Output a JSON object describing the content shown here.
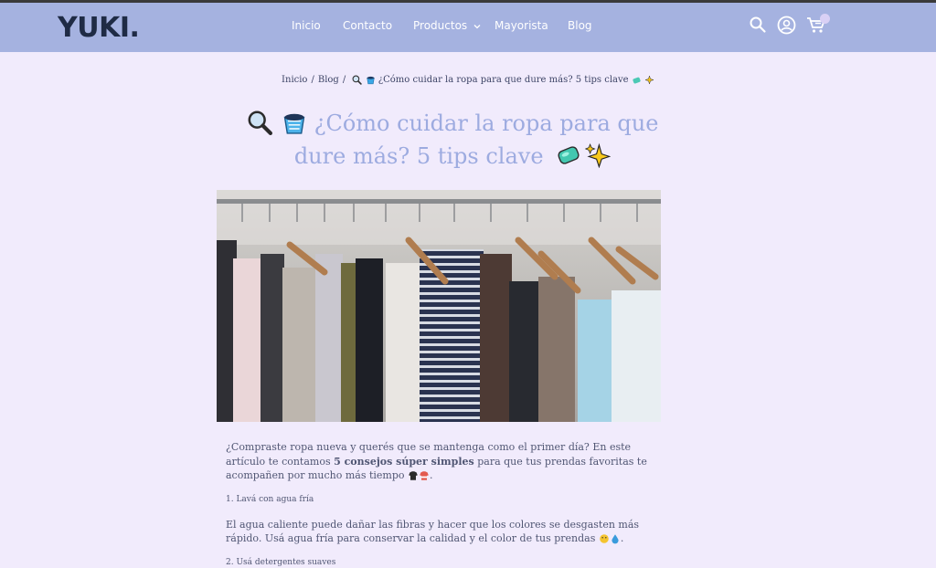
{
  "header": {
    "logo": "YUKI.",
    "nav": [
      "Inicio",
      "Contacto",
      "Productos",
      "Mayorista",
      "Blog"
    ],
    "icons": [
      "search-icon",
      "account-icon",
      "cart-icon"
    ]
  },
  "breadcrumb": {
    "items": [
      "Inicio",
      "Blog",
      "¿Cómo cuidar la ropa para que dure más? 5 tips clave"
    ],
    "separator": "/"
  },
  "post": {
    "title_line1": "¿Cómo cuidar la ropa para que",
    "title_line2": "dure más? 5 tips clave",
    "image_alt": "Ropa colgada en perchas",
    "intro_part1": "¿Compraste ropa nueva y querés que se mantenga como el primer día? En este artículo te contamos ",
    "intro_bold": "5 consejos súper simples",
    "intro_part2": " para que tus prendas favoritas te acompañen por mucho más tiempo",
    "tip1_heading": "1. Lavá con agua fría",
    "tip1_text": "El agua caliente puede dañar las fibras y hacer que los colores se desgasten más rápido. Usá agua fría para conservar la calidad y el color de tus prendas",
    "tip2_heading": "2. Usá detergentes suaves"
  },
  "colors": {
    "header_bg": "#a5b2e0",
    "page_bg": "#f1ebfc",
    "title": "#9dabe0",
    "logo": "#1f2b45"
  }
}
